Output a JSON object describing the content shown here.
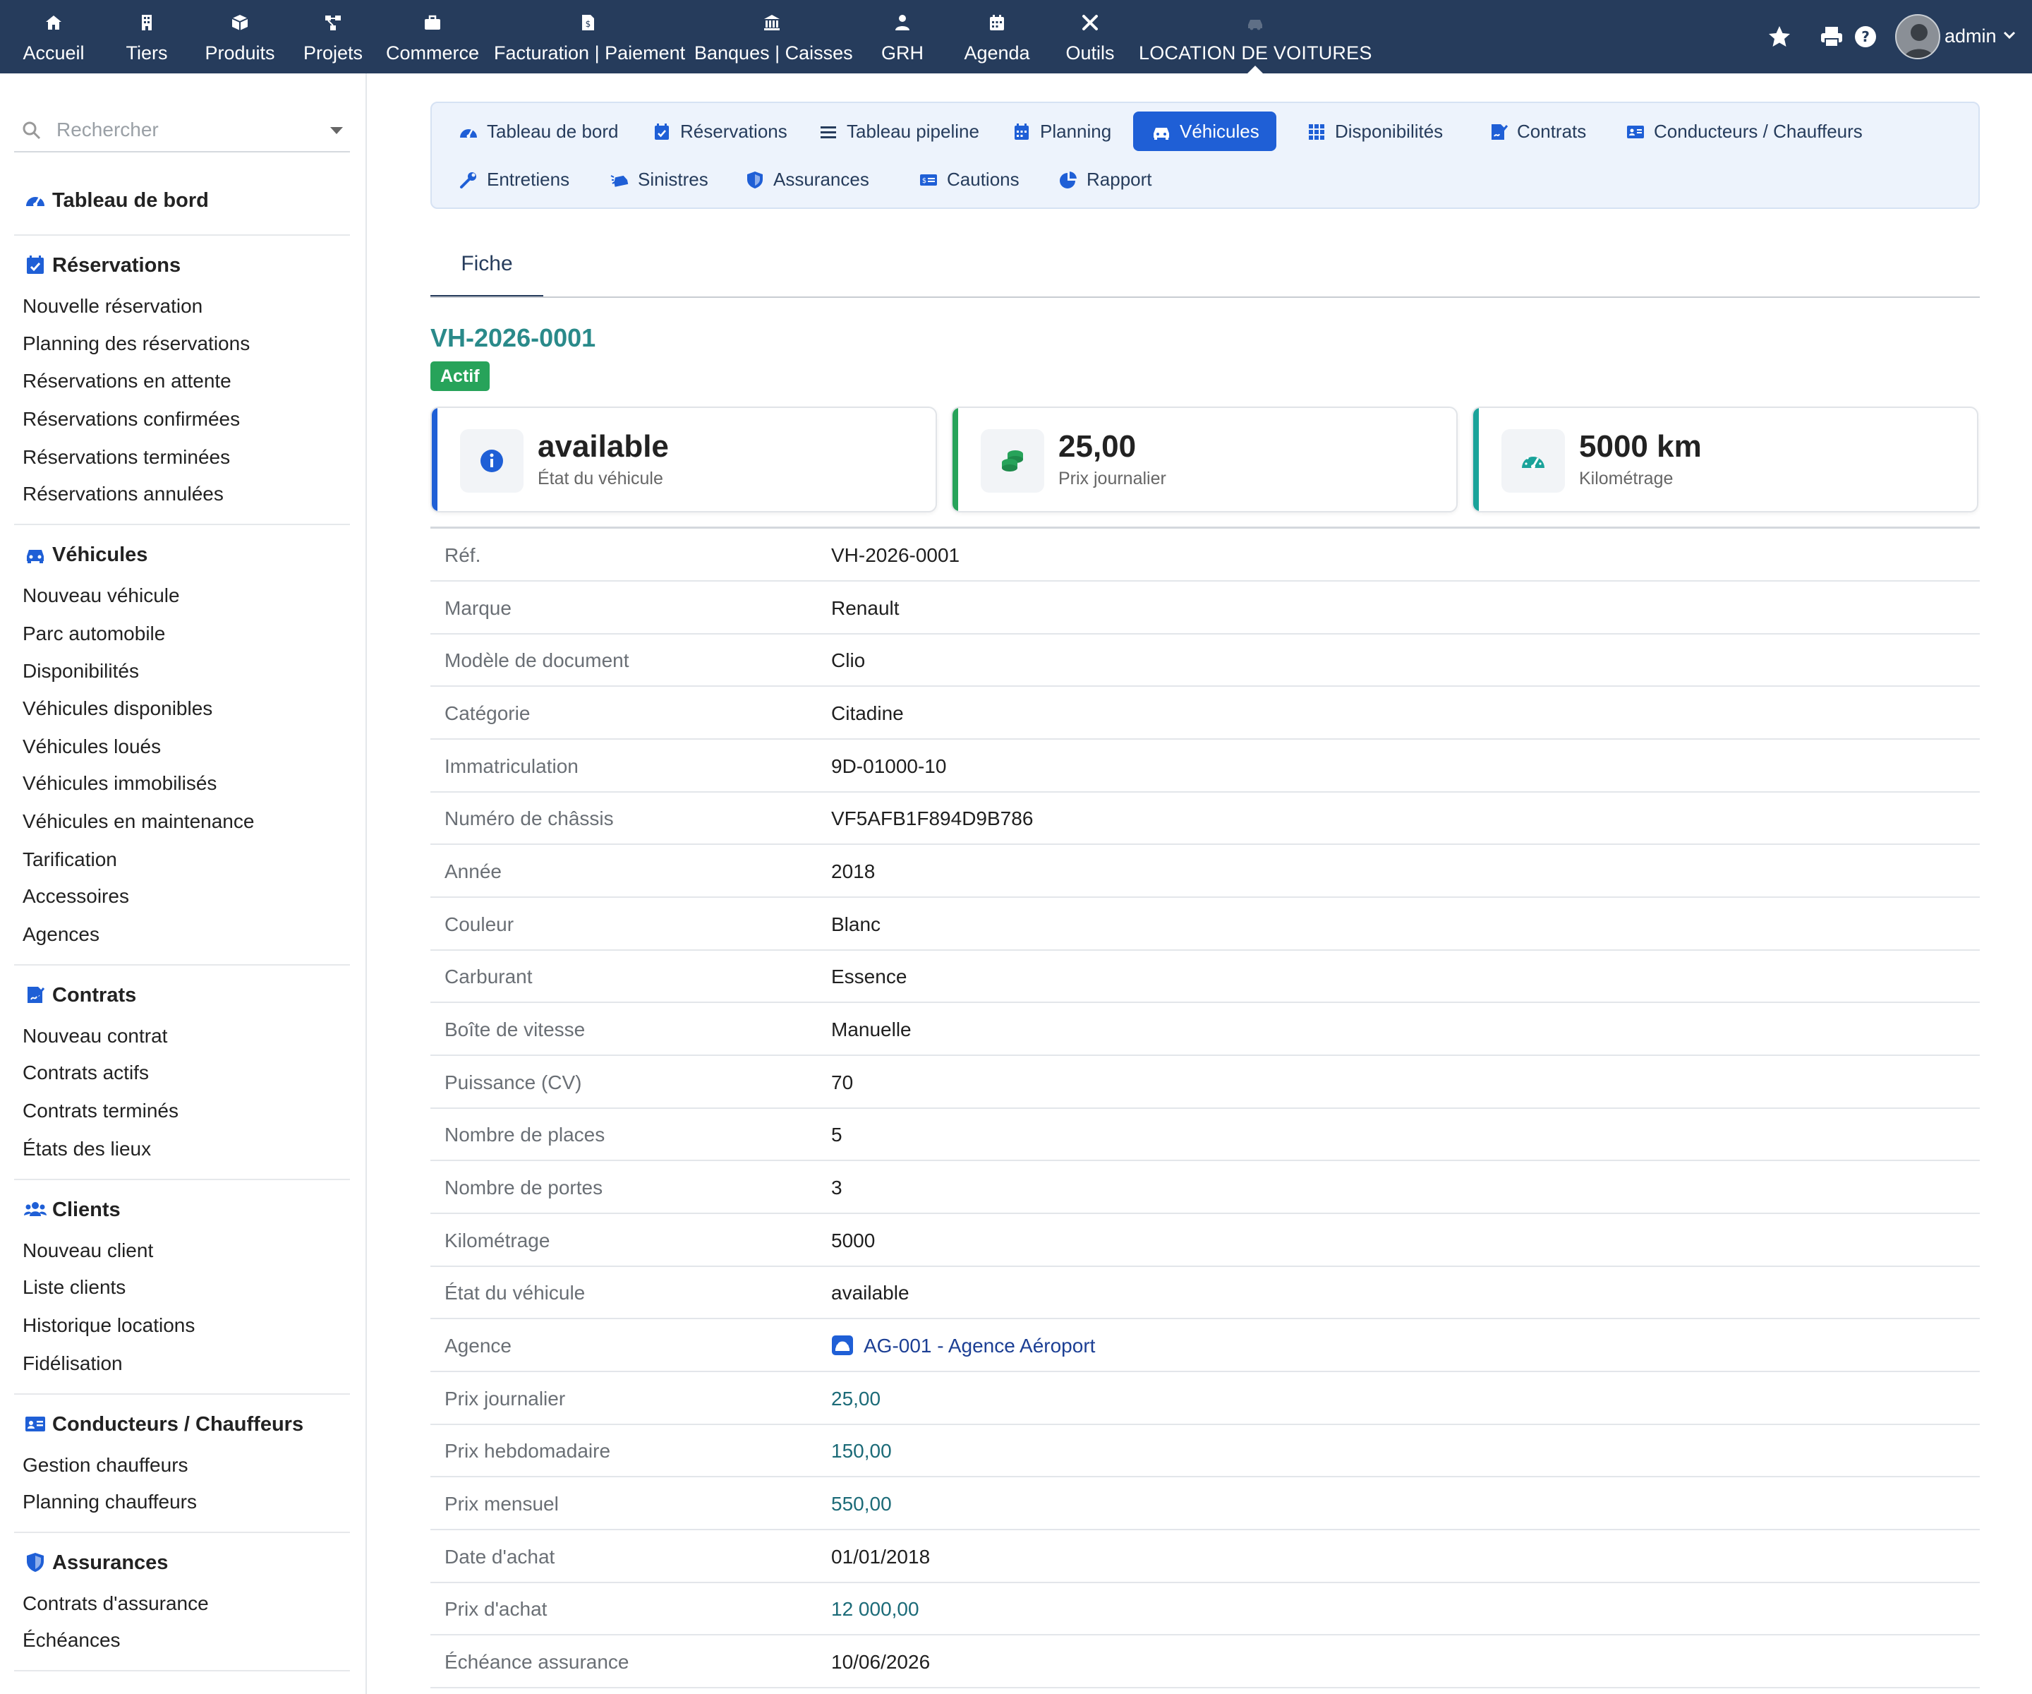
{
  "topnav": {
    "items": [
      {
        "label": "Accueil",
        "icon": "home-icon"
      },
      {
        "label": "Tiers",
        "icon": "building-icon"
      },
      {
        "label": "Produits",
        "icon": "cube-icon"
      },
      {
        "label": "Projets",
        "icon": "project-icon"
      },
      {
        "label": "Commerce",
        "icon": "briefcase-icon"
      },
      {
        "label": "Facturation | Paiement",
        "icon": "invoice-icon"
      },
      {
        "label": "Banques | Caisses",
        "icon": "bank-icon"
      },
      {
        "label": "GRH",
        "icon": "user-tie-icon"
      },
      {
        "label": "Agenda",
        "icon": "calendar-icon"
      },
      {
        "label": "Outils",
        "icon": "tools-icon"
      },
      {
        "label": "LOCATION DE VOITURES",
        "icon": "car-icon"
      }
    ],
    "user": "admin"
  },
  "sidebar": {
    "search_placeholder": "Rechercher",
    "dashboard": "Tableau de bord",
    "sections": [
      {
        "title": "Réservations",
        "icon": "calendar-check-icon",
        "items": [
          "Nouvelle réservation",
          "Planning des réservations",
          "Réservations en attente",
          "Réservations confirmées",
          "Réservations terminées",
          "Réservations annulées"
        ]
      },
      {
        "title": "Véhicules",
        "icon": "car-icon",
        "items": [
          "Nouveau véhicule",
          "Parc automobile",
          "Disponibilités",
          "Véhicules disponibles",
          "Véhicules loués",
          "Véhicules immobilisés",
          "Véhicules en maintenance",
          "Tarification",
          "Accessoires",
          "Agences"
        ]
      },
      {
        "title": "Contrats",
        "icon": "contract-icon",
        "items": [
          "Nouveau contrat",
          "Contrats actifs",
          "Contrats terminés",
          "États des lieux"
        ]
      },
      {
        "title": "Clients",
        "icon": "users-icon",
        "items": [
          "Nouveau client",
          "Liste clients",
          "Historique locations",
          "Fidélisation"
        ]
      },
      {
        "title": "Conducteurs / Chauffeurs",
        "icon": "id-card-icon",
        "items": [
          "Gestion chauffeurs",
          "Planning chauffeurs"
        ]
      },
      {
        "title": "Assurances",
        "icon": "shield-icon",
        "items": [
          "Contrats d'assurance",
          "Échéances"
        ]
      }
    ]
  },
  "module_tabs": [
    {
      "label": "Tableau de bord",
      "icon": "gauge-icon"
    },
    {
      "label": "Réservations",
      "icon": "calendar-check-icon"
    },
    {
      "label": "Tableau pipeline",
      "icon": "bars-icon"
    },
    {
      "label": "Planning",
      "icon": "calendar-icon"
    },
    {
      "label": "Véhicules",
      "icon": "car-icon",
      "active": true
    },
    {
      "label": "Disponibilités",
      "icon": "grid-icon"
    },
    {
      "label": "Contrats",
      "icon": "contract-icon"
    },
    {
      "label": "Conducteurs / Chauffeurs",
      "icon": "id-card-icon"
    },
    {
      "label": "Entretiens",
      "icon": "wrench-icon"
    },
    {
      "label": "Sinistres",
      "icon": "car-crash-icon"
    },
    {
      "label": "Assurances",
      "icon": "shield-icon"
    },
    {
      "label": "Cautions",
      "icon": "money-check-icon"
    },
    {
      "label": "Rapport",
      "icon": "pie-chart-icon"
    }
  ],
  "fiche_tab": "Fiche",
  "vehicle": {
    "ref": "VH-2026-0001",
    "status_badge": "Actif",
    "cards": [
      {
        "value": "available",
        "label": "État du véhicule",
        "icon": "info-icon",
        "color": "#1f5fd6"
      },
      {
        "value": "25,00",
        "label": "Prix journalier",
        "icon": "coins-icon",
        "color": "#27a35a"
      },
      {
        "value": "5000 km",
        "label": "Kilométrage",
        "icon": "speedometer-icon",
        "color": "#1aa39a"
      }
    ],
    "fields": [
      {
        "label": "Réf.",
        "value": "VH-2026-0001"
      },
      {
        "label": "Marque",
        "value": "Renault"
      },
      {
        "label": "Modèle de document",
        "value": "Clio"
      },
      {
        "label": "Catégorie",
        "value": "Citadine"
      },
      {
        "label": "Immatriculation",
        "value": "9D-01000-10"
      },
      {
        "label": "Numéro de châssis",
        "value": "VF5AFB1F894D9B786"
      },
      {
        "label": "Année",
        "value": "2018"
      },
      {
        "label": "Couleur",
        "value": "Blanc"
      },
      {
        "label": "Carburant",
        "value": "Essence"
      },
      {
        "label": "Boîte de vitesse",
        "value": "Manuelle"
      },
      {
        "label": "Puissance (CV)",
        "value": "70"
      },
      {
        "label": "Nombre de places",
        "value": "5"
      },
      {
        "label": "Nombre de portes",
        "value": "3"
      },
      {
        "label": "Kilométrage",
        "value": "5000"
      },
      {
        "label": "État du véhicule",
        "value": "available"
      },
      {
        "label": "Agence",
        "value": "AG-001 - Agence Aéroport",
        "type": "link"
      },
      {
        "label": "Prix journalier",
        "value": "25,00",
        "type": "num"
      },
      {
        "label": "Prix hebdomadaire",
        "value": "150,00",
        "type": "num"
      },
      {
        "label": "Prix mensuel",
        "value": "550,00",
        "type": "num"
      },
      {
        "label": "Date d'achat",
        "value": "01/01/2018"
      },
      {
        "label": "Prix d'achat",
        "value": "12 000,00",
        "type": "num"
      },
      {
        "label": "Échéance assurance",
        "value": "10/06/2026"
      }
    ]
  }
}
